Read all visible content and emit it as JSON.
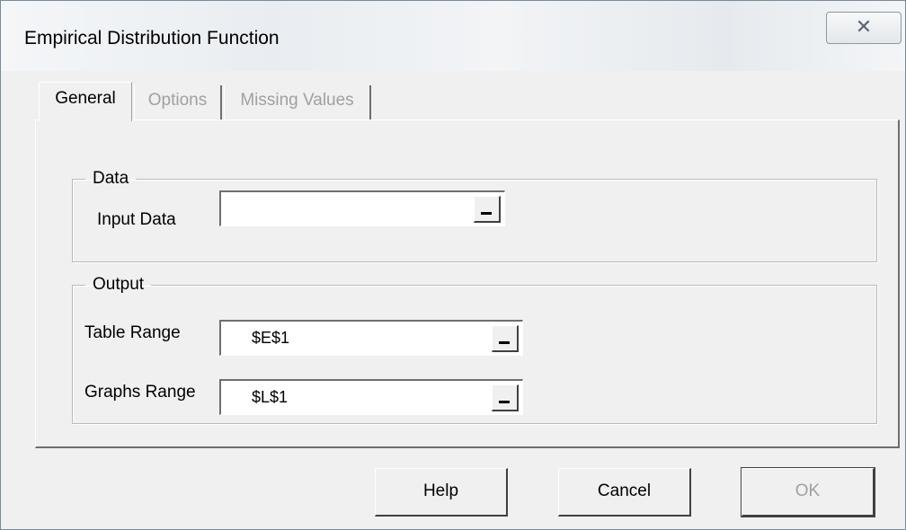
{
  "window": {
    "title": "Empirical Distribution Function",
    "close_glyph": "✕"
  },
  "tabs": [
    {
      "label": "General",
      "active": true
    },
    {
      "label": "Options",
      "active": false
    },
    {
      "label": "Missing Values",
      "active": false
    }
  ],
  "data_group": {
    "legend": "Data",
    "input_data_label": "Input Data",
    "input_data_value": ""
  },
  "output_group": {
    "legend": "Output",
    "table_range_label": "Table Range",
    "table_range_value": "$E$1",
    "graphs_range_label": "Graphs Range",
    "graphs_range_value": "$L$1"
  },
  "buttons": {
    "help": "Help",
    "cancel": "Cancel",
    "ok": "OK"
  },
  "icons": {
    "close": "close-icon",
    "range_select": "range-select-icon"
  }
}
